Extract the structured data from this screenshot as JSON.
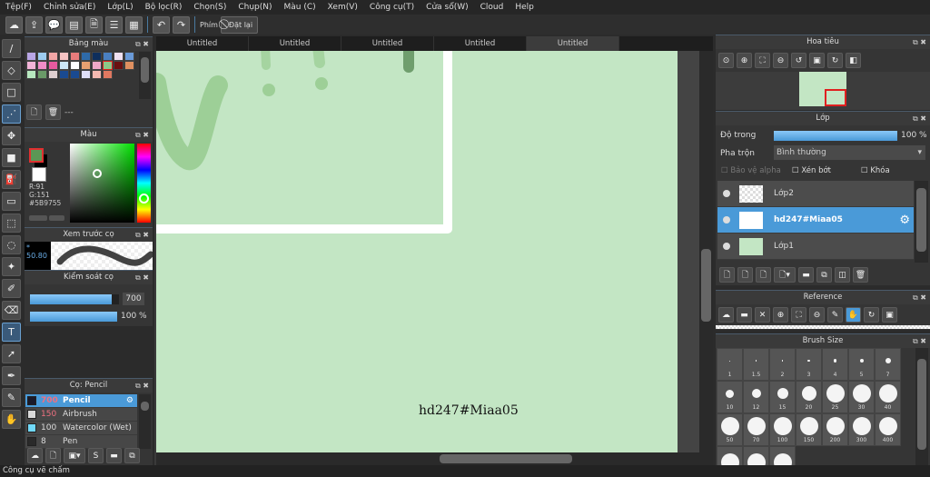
{
  "menu": [
    "Tệp(F)",
    "Chỉnh sửa(E)",
    "Lớp(L)",
    "Bộ lọc(R)",
    "Chọn(S)",
    "Chụp(N)",
    "Màu (C)",
    "Xem(V)",
    "Công cụ(T)",
    "Cửa sổ(W)",
    "Cloud",
    "Help"
  ],
  "toolbar": {
    "icons": [
      "cloud-icon",
      "share-icon",
      "comment-icon",
      "message-icon",
      "document-icon",
      "settings-list-icon",
      "layout-icon"
    ],
    "undo": "undo-icon",
    "redo": "redo-icon",
    "shortcut_label": "Phím",
    "reset_label": "Đặt lại"
  },
  "tools": [
    "brush-icon",
    "eraser-icon",
    "square-icon",
    "dot-brush-icon",
    "move-icon",
    "fill-rect-icon",
    "bucket-icon",
    "gradient-icon",
    "rect-select-icon",
    "lasso-icon",
    "magic-wand-icon",
    "select-pen-icon",
    "select-eraser-icon",
    "text-icon",
    "operation-icon",
    "pen-icon",
    "eyedropper-icon",
    "hand-icon"
  ],
  "palette": {
    "title": "Bảng màu",
    "colors": [
      "#b9a6e6",
      "#9dcbf0",
      "#f2a6a6",
      "#f7c4c4",
      "#e87c7c",
      "#2e6aa8",
      "#0e2e5c",
      "#4a7fc0",
      "#f0e0f0",
      "#6a9ad8",
      "#f2b4d8",
      "#f08cc8",
      "#e85aa0",
      "#cce8f8",
      "#ffffff",
      "#e8a070",
      "#f0a8c8",
      "#8cc888",
      "#6a1010",
      "#e09060",
      "#b8e8c0",
      "#6a9a68",
      "#e0d0d0",
      "#1a4a90",
      "#1a4a90",
      "#e0e0f8",
      "#f4b8b0",
      "#e07860"
    ],
    "selected_index": 17,
    "name": "---"
  },
  "color": {
    "title": "Màu",
    "fg": "#5B9755",
    "r": "R:91",
    "g": "G:151",
    "hex": "#5B9755"
  },
  "preview": {
    "title": "Xem trước cọ",
    "size": "50.80"
  },
  "brush_control": {
    "title": "Kiểm soát cọ",
    "size": "700",
    "opacity": "100 %",
    "size_fill": 0.92,
    "opacity_fill": 1.0
  },
  "brush_list": {
    "title": "Cọ: Pencil",
    "items": [
      {
        "size": "700",
        "name": "Pencil",
        "color": "#1a1a2a",
        "selected": true
      },
      {
        "size": "150",
        "name": "Airbrush",
        "color": "#d8d8d8"
      },
      {
        "size": "100",
        "name": "Watercolor (Wet)",
        "color": "#70d8f8"
      },
      {
        "size": "8",
        "name": "Pen",
        "color": "#2a2a2a"
      }
    ]
  },
  "tabs": [
    "Untitled",
    "Untitled",
    "Untitled",
    "Untitled",
    "Untitled"
  ],
  "canvas": {
    "text": "hd247#Miaa05",
    "bg": "#c3e6c4"
  },
  "navigator": {
    "title": "Hoa tiêu"
  },
  "layers": {
    "title": "Lớp",
    "opacity_label": "Độ trong",
    "opacity": "100 %",
    "blend_label": "Pha trộn",
    "blend": "Bình thường",
    "alpha_protect": "Bảo vệ alpha",
    "clip": "Xén bớt",
    "lock": "Khóa",
    "items": [
      {
        "name": "Lớp2"
      },
      {
        "name": "hd247#Miaa05",
        "selected": true
      },
      {
        "name": "Lớp1"
      }
    ]
  },
  "reference": {
    "title": "Reference"
  },
  "brush_size": {
    "title": "Brush Size",
    "sizes": [
      "1",
      "1.5",
      "2",
      "3",
      "4",
      "5",
      "7",
      "10",
      "12",
      "15",
      "20",
      "25",
      "30",
      "40",
      "50",
      "70",
      "100",
      "150",
      "200",
      "300",
      "400"
    ]
  },
  "status": "Công cụ vẽ chấm"
}
